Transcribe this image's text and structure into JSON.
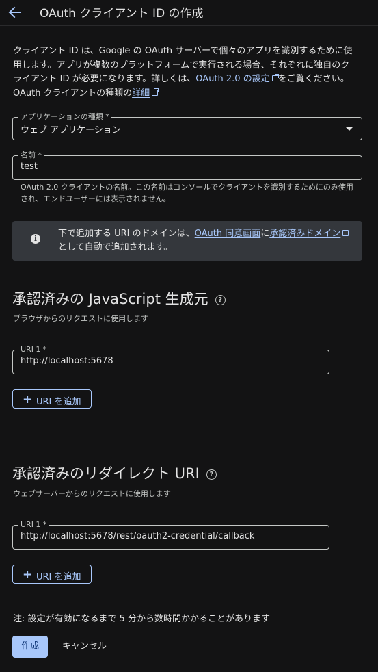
{
  "header": {
    "title": "OAuth クライアント ID の作成",
    "back_icon": "arrow-back-icon"
  },
  "description": {
    "text1": "クライアント ID は、Google の OAuth サーバーで個々のアプリを識別するために使用します。アプリが複数のプラットフォームで実行される場合、それぞれに独自のクライアント ID が必要になります。詳しくは、",
    "link1": "OAuth 2.0 の設定",
    "text2": "をご覧ください。 OAuth クライアントの種類の",
    "link2": "詳細"
  },
  "app_type": {
    "label": "アプリケーションの種類 *",
    "value": "ウェブ アプリケーション"
  },
  "name_field": {
    "label": "名前 *",
    "value": "test",
    "hint": "OAuth 2.0 クライアントの名前。この名前はコンソールでクライアントを識別するためにのみ使用され、エンドユーザーには表示されません。"
  },
  "info_box": {
    "text1": "下で追加する URI のドメインは、",
    "link1": "OAuth 同意画面",
    "text2": "に",
    "link2": "承認済みドメイン",
    "text3": "として自動で追加されます。"
  },
  "js_origins": {
    "title": "承認済みの JavaScript 生成元",
    "subtitle": "ブラウザからのリクエストに使用します",
    "uri_label": "URI 1 *",
    "uri_value": "http://localhost:5678",
    "add_label": "URI を追加"
  },
  "redirect_uris": {
    "title": "承認済みのリダイレクト URI",
    "subtitle": "ウェブサーバーからのリクエストに使用します",
    "uri_label": "URI 1 *",
    "uri_value": "http://localhost:5678/rest/oauth2-credential/callback",
    "add_label": "URI を追加"
  },
  "note": "注: 設定が有効になるまで 5 分から数時間かかることがあります",
  "actions": {
    "create": "作成",
    "cancel": "キャンセル"
  },
  "colors": {
    "background": "#131314",
    "link": "#a8c7fa",
    "primary_button": "#a8c7fa",
    "info_box": "#34373c"
  }
}
